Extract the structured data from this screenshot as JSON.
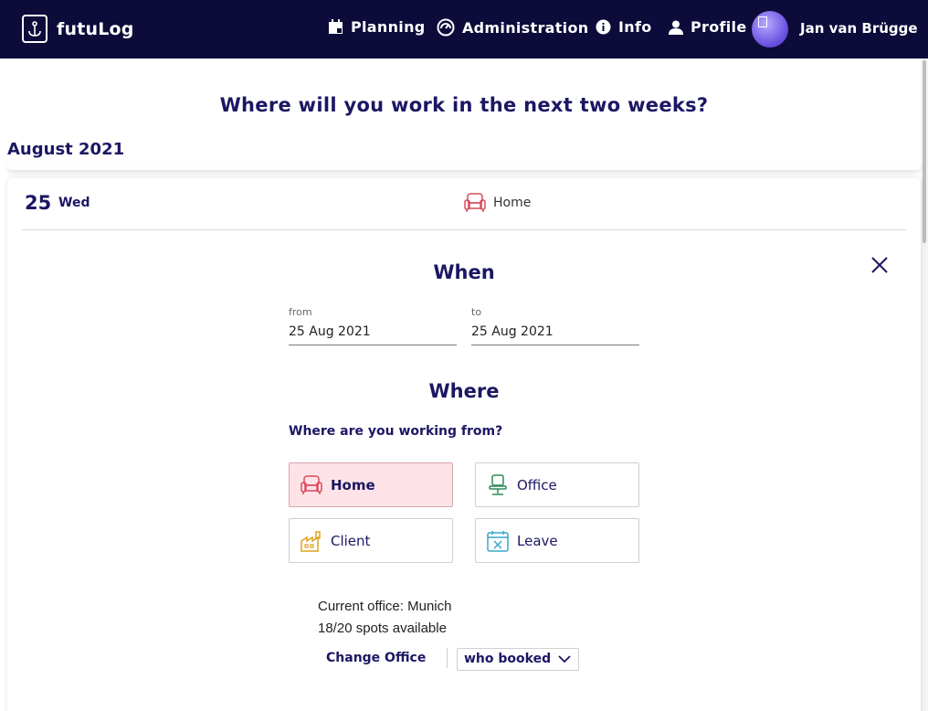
{
  "app": {
    "name": "futuLog"
  },
  "nav": {
    "planning": "Planning",
    "administration": "Administration",
    "info": "Info",
    "profile": "Profile",
    "user_name": "Jan van Brügge"
  },
  "page": {
    "title": "Where will you work in the next two weeks?"
  },
  "month": {
    "label": "August 2021"
  },
  "day": {
    "number": "25",
    "weekday": "Wed",
    "status": "Home"
  },
  "when": {
    "heading": "When",
    "from_label": "from",
    "from_value": "25 Aug 2021",
    "to_label": "to",
    "to_value": "25 Aug 2021"
  },
  "where": {
    "heading": "Where",
    "question": "Where are you working from?",
    "options": [
      {
        "label": "Home",
        "icon": "armchair-icon",
        "selected": true
      },
      {
        "label": "Office",
        "icon": "office-chair-icon",
        "selected": false
      },
      {
        "label": "Client",
        "icon": "factory-icon",
        "selected": false
      },
      {
        "label": "Leave",
        "icon": "calendar-x-icon",
        "selected": false
      }
    ]
  },
  "office": {
    "current": "Current office: Munich",
    "spots": "18/20 spots available",
    "change_label": "Change Office",
    "who_booked_label": "who booked"
  },
  "colors": {
    "nav_bg": "#0c0b3a",
    "accent": "#1c1763",
    "selected_bg": "#fde3e7",
    "home_icon": "#d94a5c",
    "office_icon": "#2e8b57",
    "client_icon": "#e0a21b",
    "leave_icon": "#3aa7c9"
  }
}
